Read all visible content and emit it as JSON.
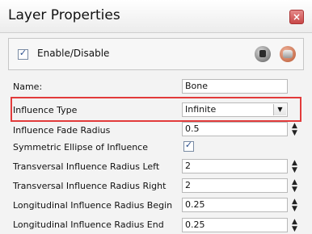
{
  "window": {
    "title": "Layer Properties",
    "close_icon": "close-icon"
  },
  "enable": {
    "label": "Enable/Disable",
    "checked": true,
    "icons": [
      "lock-icon",
      "database-icon"
    ]
  },
  "name": {
    "label": "Name:",
    "value": "Bone"
  },
  "influence_type": {
    "label": "Influence Type",
    "value": "Infinite"
  },
  "fields": [
    {
      "label": "Influence Fade Radius",
      "value": "0.5"
    },
    {
      "label": "Symmetric Ellipse of Influence",
      "value": "",
      "checked": true
    },
    {
      "label": "Transversal Influence Radius Left",
      "value": "2"
    },
    {
      "label": "Transversal Influence Radius Right",
      "value": "2"
    },
    {
      "label": "Longitudinal Influence Radius Begin",
      "value": "0.25"
    },
    {
      "label": "Longitudinal Influence Radius End",
      "value": "0.25"
    }
  ],
  "colors": {
    "highlight": "#e23b3b",
    "close_button": "#c84747"
  }
}
